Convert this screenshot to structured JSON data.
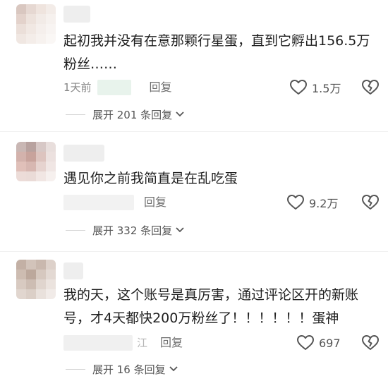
{
  "comments": [
    {
      "text": "起初我并没有在意那颗行星蛋，直到它孵出156.5万粉丝……",
      "time": "1天前",
      "location": "",
      "reply_label": "回复",
      "likes": "1.5万",
      "expand_label": "展开 201 条回复"
    },
    {
      "text": "遇见你之前我简直是在乱吃蛋",
      "time": "",
      "location": "",
      "reply_label": "回复",
      "likes": "9.2万",
      "expand_label": "展开 332 条回复"
    },
    {
      "text": "我的天，这个账号是真厉害，通过评论区开的新账号，才4天都快200万粉丝了！！！！！！蛋神",
      "time": "",
      "location": "江",
      "reply_label": "回复",
      "likes": "697",
      "expand_label": "展开 16 条回复"
    }
  ],
  "icons": {
    "like": "heart-outline-icon",
    "dislike": "broken-heart-icon",
    "expand": "chevron-down-icon"
  },
  "colors": {
    "text": "#1f1f1f",
    "meta": "#888888",
    "icon": "#555555"
  }
}
